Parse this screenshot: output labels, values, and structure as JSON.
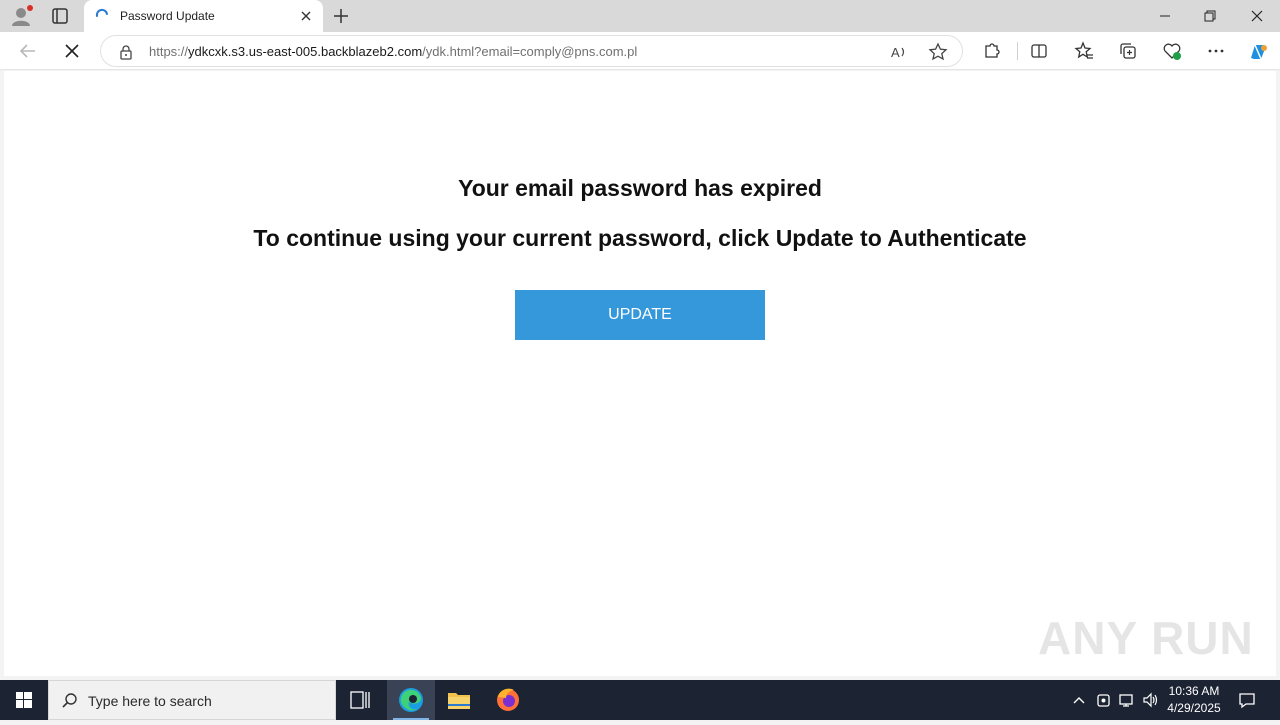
{
  "browser": {
    "tab": {
      "title": "Password Update"
    },
    "address": {
      "url_scheme": "https://",
      "url_host": "ydkcxk.s3.us-east-005.backblazeb2.com",
      "url_path": "/ydk.html?email=comply@pns.com.pl"
    }
  },
  "page": {
    "heading": "Your email password has expired",
    "subheading": "To continue using your current password, click Update to Authenticate",
    "button_label": "UPDATE",
    "button_color": "#3598db",
    "watermark": "ANY RUN"
  },
  "taskbar": {
    "search_placeholder": "Type here to search",
    "time": "10:36 AM",
    "date": "4/29/2025"
  }
}
